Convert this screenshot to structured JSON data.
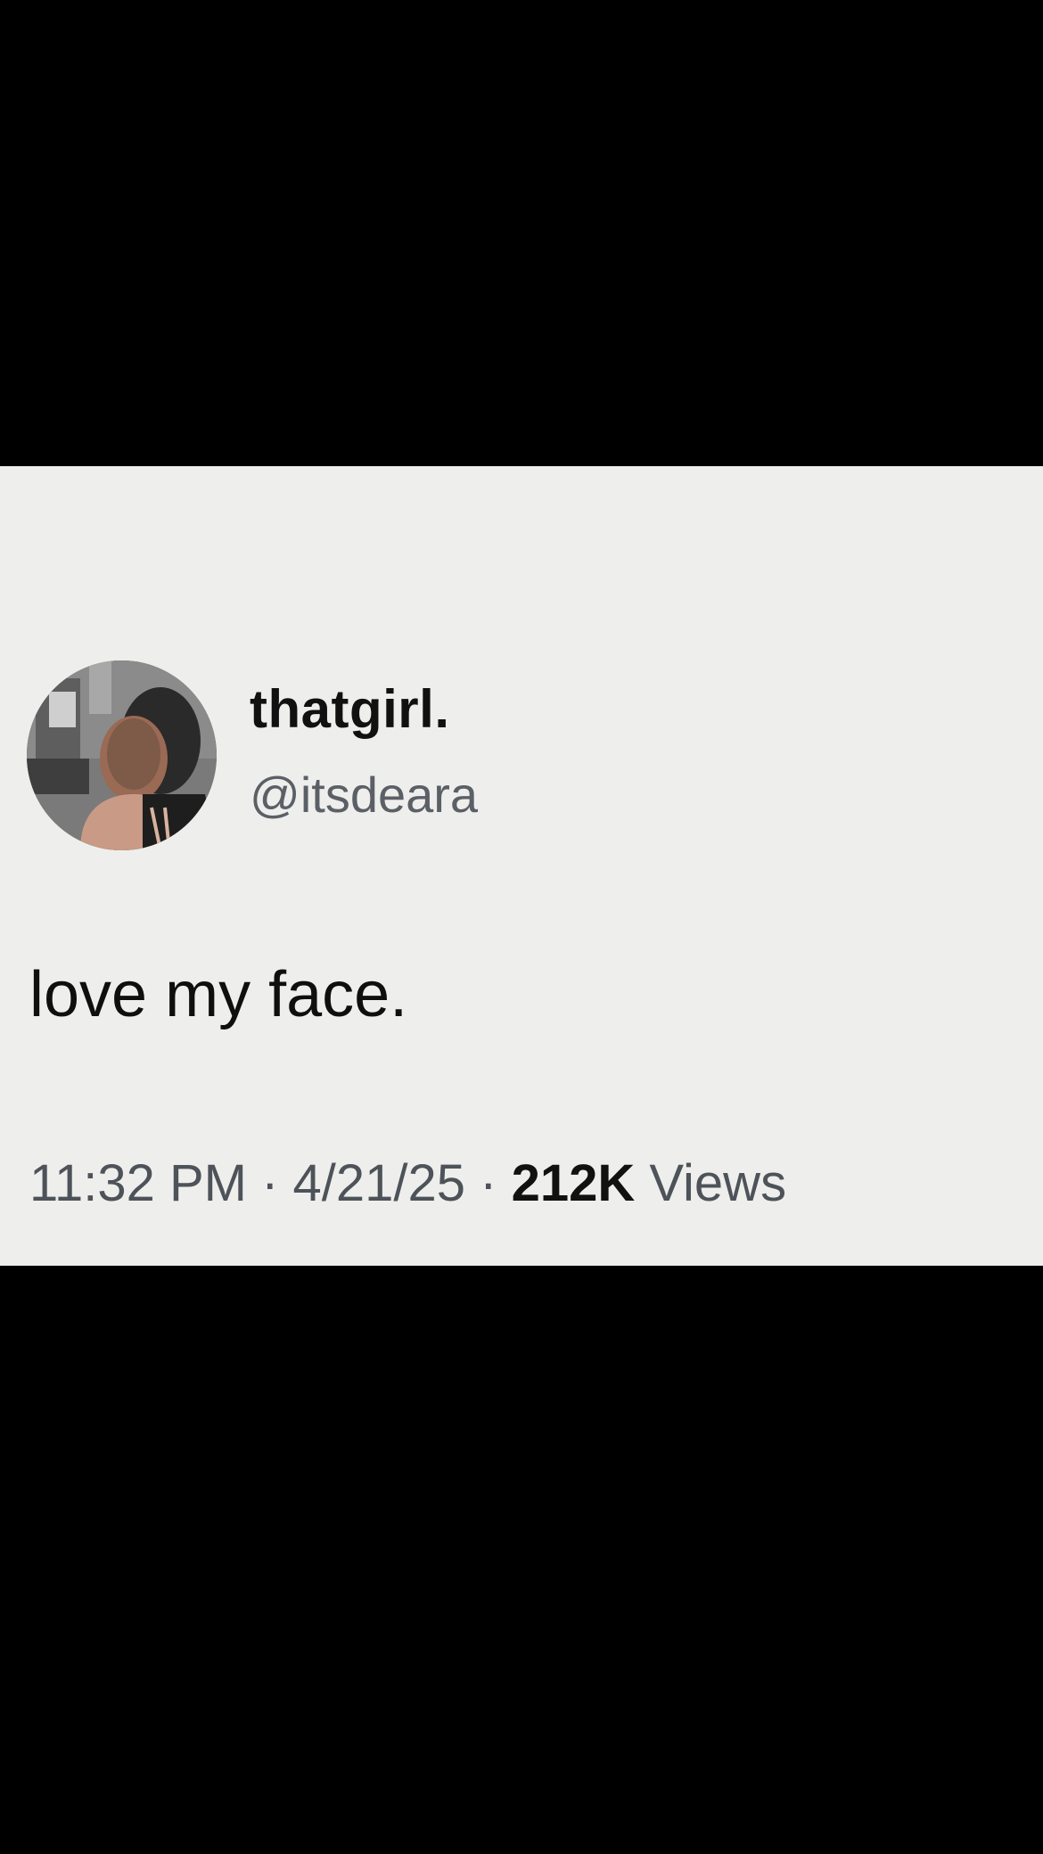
{
  "colors": {
    "letterbox": "#000000",
    "card_background": "#eeefec",
    "name_text": "#111111",
    "handle_text": "#5b6066",
    "meta_text": "#4e535a"
  },
  "tweet": {
    "author": {
      "display_name": "thatgirl.",
      "handle": "@itsdeara",
      "avatar_icon": "profile-photo-avatar"
    },
    "text": "love my face.",
    "meta": {
      "time": "11:32 PM",
      "separator": "·",
      "date": "4/21/25",
      "views_count": "212K",
      "views_label": "Views"
    }
  }
}
